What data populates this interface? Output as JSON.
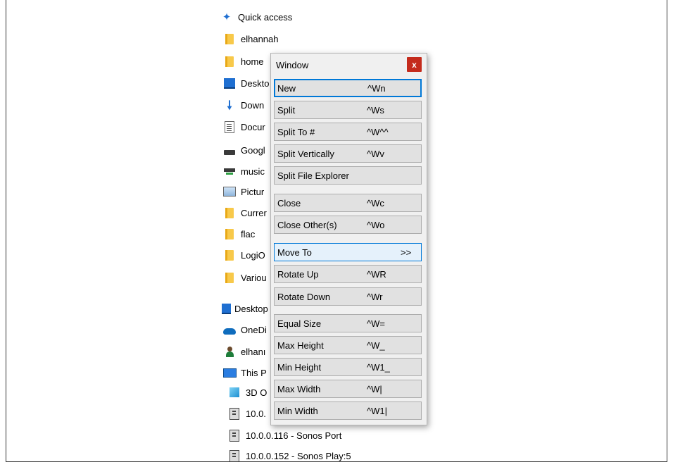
{
  "nav": {
    "quick_access": "Quick access",
    "items": [
      {
        "label": "elhannah",
        "icon": "folder-icon"
      },
      {
        "label": "home",
        "icon": "network-folder-icon"
      },
      {
        "label": "Deskto",
        "icon": "desktop-icon"
      },
      {
        "label": "Down",
        "icon": "downloads-icon"
      },
      {
        "label": "Docur",
        "icon": "documents-icon"
      },
      {
        "label": "Googl",
        "icon": "drive-icon"
      },
      {
        "label": "music",
        "icon": "network-drive-icon"
      },
      {
        "label": "Pictur",
        "icon": "pictures-icon"
      },
      {
        "label": "Currer",
        "icon": "folder-icon"
      },
      {
        "label": "flac",
        "icon": "folder-icon"
      },
      {
        "label": "LogiO",
        "icon": "folder-icon"
      },
      {
        "label": "Variou",
        "icon": "folder-icon"
      }
    ],
    "desktop": "Desktop",
    "onedrive": "OneDi",
    "user": "elhanı",
    "this_pc": "This P",
    "pc_items": [
      {
        "label": "3D O",
        "icon": "3d-objects-icon"
      },
      {
        "label": "10.0.",
        "icon": "network-device-icon"
      },
      {
        "label": "10.0.0.116 - Sonos Port",
        "icon": "network-device-icon"
      },
      {
        "label": "10.0.0.152 - Sonos Play:5",
        "icon": "network-device-icon"
      }
    ]
  },
  "dialog": {
    "title": "Window",
    "close": "x",
    "buttons": [
      {
        "label": "New",
        "key": "^Wn"
      },
      {
        "label": "Split",
        "key": "^Ws"
      },
      {
        "label": "Split To #",
        "key": "^W^^"
      },
      {
        "label": "Split Vertically",
        "key": "^Wv"
      },
      {
        "label": "Split File Explorer",
        "key": ""
      },
      {
        "label": "Close",
        "key": "^Wc"
      },
      {
        "label": "Close Other(s)",
        "key": "^Wo"
      },
      {
        "label": "Move To",
        "key": ">>"
      },
      {
        "label": "Rotate Up",
        "key": "^WR"
      },
      {
        "label": "Rotate Down",
        "key": "^Wr"
      },
      {
        "label": "Equal Size",
        "key": "^W="
      },
      {
        "label": "Max Height",
        "key": "^W_"
      },
      {
        "label": "Min Height",
        "key": "^W1_"
      },
      {
        "label": "Max Width",
        "key": "^W|"
      },
      {
        "label": "Min Width",
        "key": "^W1|"
      }
    ]
  }
}
